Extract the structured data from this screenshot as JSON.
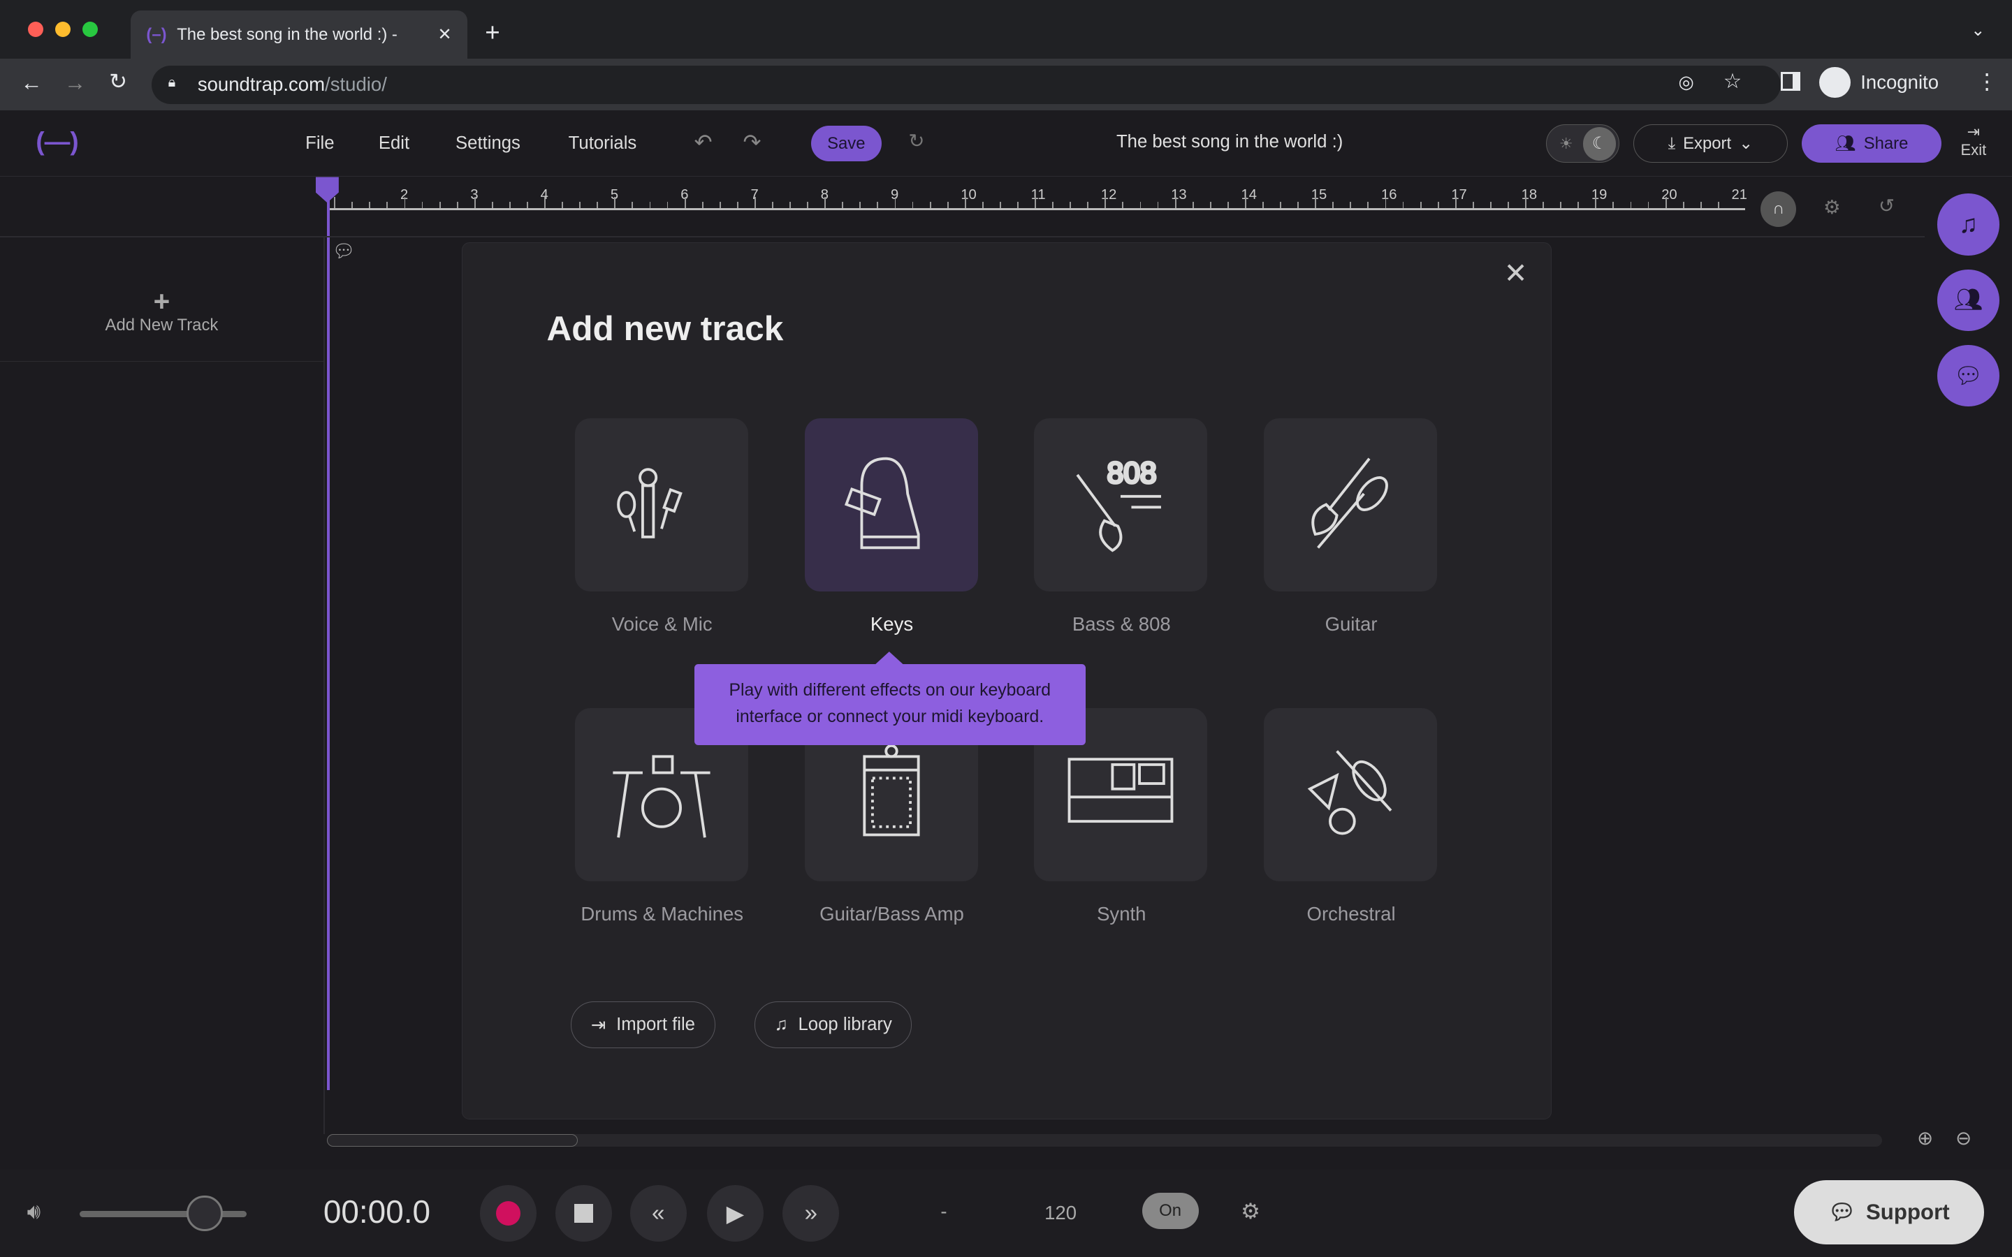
{
  "browser": {
    "tab_title": "The best song in the world :) -",
    "url_domain": "soundtrap.com",
    "url_path": "/studio/",
    "profile": "Incognito"
  },
  "app": {
    "menu": [
      "File",
      "Edit",
      "Settings",
      "Tutorials"
    ],
    "save": "Save",
    "song_title": "The best song in the world :)",
    "export": "Export",
    "share": "Share",
    "exit": "Exit",
    "accent": "#7b56cf"
  },
  "ruler": [
    "2",
    "3",
    "4",
    "5",
    "6",
    "7",
    "8",
    "9",
    "10",
    "11",
    "12",
    "13",
    "14",
    "15",
    "16",
    "17",
    "18",
    "19",
    "20",
    "21"
  ],
  "sidebar": {
    "add_track": "Add New Track"
  },
  "modal": {
    "title": "Add new track",
    "tracks": [
      {
        "label": "Voice & Mic",
        "icon": "microphones-icon"
      },
      {
        "label": "Keys",
        "icon": "piano-icon"
      },
      {
        "label": "Bass & 808",
        "icon": "bass-808-icon"
      },
      {
        "label": "Guitar",
        "icon": "guitars-icon"
      },
      {
        "label": "Drums & Machines",
        "icon": "drums-icon"
      },
      {
        "label": "Guitar/Bass Amp",
        "icon": "amp-icon"
      },
      {
        "label": "Synth",
        "icon": "synth-icon"
      },
      {
        "label": "Orchestral",
        "icon": "orchestral-icon"
      }
    ],
    "tooltip": "Play with different effects on our keyboard interface or connect your midi keyboard.",
    "import": "Import file",
    "loop": "Loop library"
  },
  "transport": {
    "time": "00:00.0",
    "key": "-",
    "tempo": "120",
    "metronome": "On",
    "volume": 0.75,
    "support": "Support",
    "record_color": "#d0105e"
  }
}
